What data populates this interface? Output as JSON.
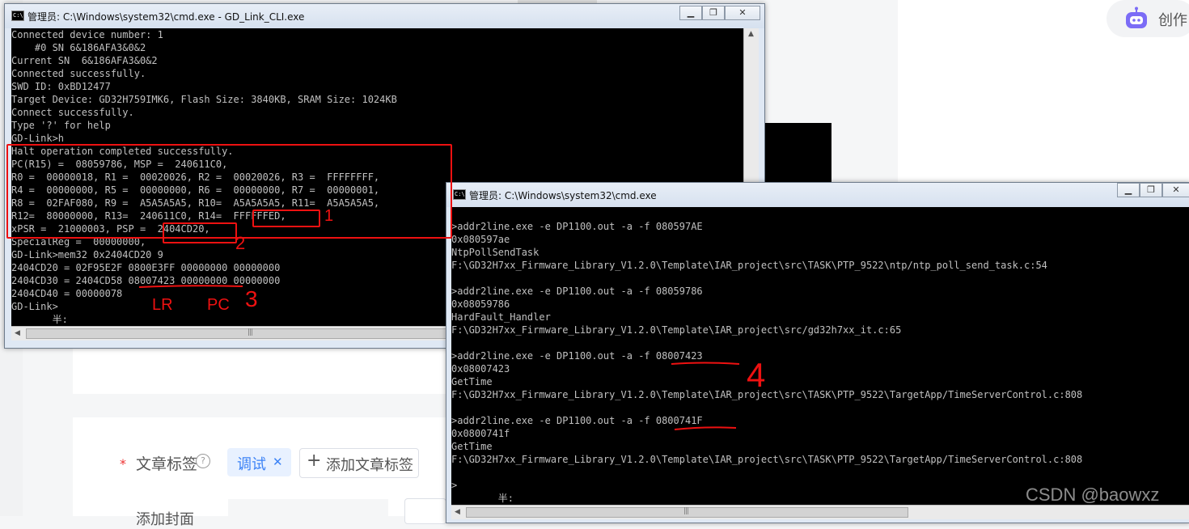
{
  "background": {
    "create_label": "创作",
    "tag_label": "文章标签",
    "tag_chip": "调试",
    "add_tag": "添加文章标签",
    "cover_label": "添加封面"
  },
  "window1": {
    "title": "管理员: C:\\Windows\\system32\\cmd.exe - GD_Link_CLI.exe",
    "lines": [
      "Connected device number: 1",
      "    #0 SN 6&186AFA3&0&2",
      "Current SN  6&186AFA3&0&2",
      "Connected successfully.",
      "SWD ID: 0xBD12477",
      "Target Device: GD32H759IMK6, Flash Size: 3840KB, SRAM Size: 1024KB",
      "Connect successfully.",
      "Type '?' for help",
      "GD-Link>h",
      "Halt operation completed successfully.",
      "PC(R15) =  08059786, MSP =  240611C0,",
      "R0 =  00000018, R1 =  00020026, R2 =  00020026, R3 =  FFFFFFFF,",
      "R4 =  00000000, R5 =  00000000, R6 =  00000000, R7 =  00000001,",
      "R8 =  02FAF080, R9 =  A5A5A5A5, R10=  A5A5A5A5, R11=  A5A5A5A5,",
      "R12=  80000000, R13=  240611C0, R14=  FFFFFFED,",
      "xPSR =  21000003, PSP =  2404CD20,",
      "SpecialReg =  00000000,",
      "GD-Link>mem32 0x2404CD20 9",
      "2404CD20 = 02F95E2F 0800E3FF 00000000 00000000",
      "2404CD30 = 2404CD58 08007423 00000000 00000000",
      "2404CD40 = 00000078",
      "GD-Link>",
      "       半:"
    ]
  },
  "window2": {
    "title": "管理员: C:\\Windows\\system32\\cmd.exe",
    "lines": [
      "",
      ">addr2line.exe -e DP1100.out -a -f 080597AE",
      "0x080597ae",
      "NtpPollSendTask",
      "F:\\GD32H7xx_Firmware_Library_V1.2.0\\Template\\IAR_project\\src\\TASK\\PTP_9522\\ntp/ntp_poll_send_task.c:54",
      "",
      ">addr2line.exe -e DP1100.out -a -f 08059786",
      "0x08059786",
      "HardFault_Handler",
      "F:\\GD32H7xx_Firmware_Library_V1.2.0\\Template\\IAR_project\\src/gd32h7xx_it.c:65",
      "",
      ">addr2line.exe -e DP1100.out -a -f 08007423",
      "0x08007423",
      "GetTime",
      "F:\\GD32H7xx_Firmware_Library_V1.2.0\\Template\\IAR_project\\src\\TASK\\PTP_9522\\TargetApp/TimeServerControl.c:808",
      "",
      ">addr2line.exe -e DP1100.out -a -f 0800741F",
      "0x0800741f",
      "GetTime",
      "F:\\GD32H7xx_Firmware_Library_V1.2.0\\Template\\IAR_project\\src\\TASK\\PTP_9522\\TargetApp/TimeServerControl.c:808",
      "",
      ">",
      "        半:"
    ]
  },
  "annotations": {
    "n1": "1",
    "n2": "2",
    "n3": "3",
    "n4": "4",
    "lr": "LR",
    "pc": "PC"
  },
  "watermark": "CSDN @baowxz",
  "colors": {
    "console_bg": "#000000",
    "console_text": "#c0c0c0",
    "annotation": "#e11111",
    "tag_chip": "#3b82f6"
  }
}
